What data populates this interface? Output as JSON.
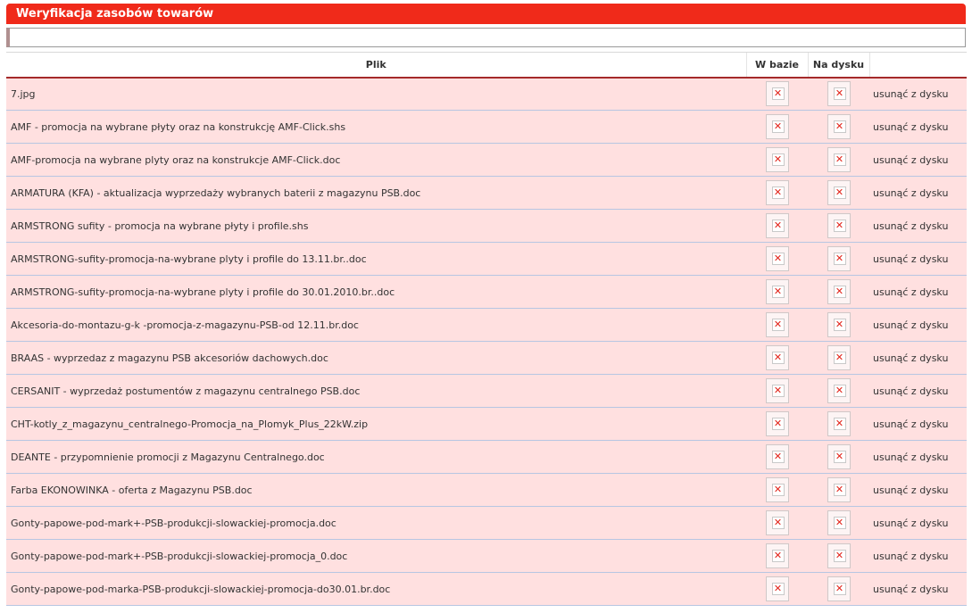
{
  "window": {
    "title": "Weryfikacja zasobów towarów"
  },
  "filter": {
    "value": "",
    "placeholder": ""
  },
  "table": {
    "columns": [
      "Plik",
      "W bazie",
      "Na dysku",
      ""
    ],
    "check_glyph": "✕",
    "check_icon": "red-x-icon",
    "action_label": "usunąć z dysku",
    "rows": [
      {
        "file": "7.jpg",
        "in_db": false,
        "on_disk": false
      },
      {
        "file": "AMF - promocja na wybrane płyty oraz na konstrukcję AMF-Click.shs",
        "in_db": false,
        "on_disk": false
      },
      {
        "file": "AMF-promocja na wybrane plyty oraz na konstrukcje AMF-Click.doc",
        "in_db": false,
        "on_disk": false
      },
      {
        "file": "ARMATURA (KFA) - aktualizacja wyprzedaży wybranych baterii z magazynu PSB.doc",
        "in_db": false,
        "on_disk": false
      },
      {
        "file": "ARMSTRONG sufity - promocja na wybrane płyty i profile.shs",
        "in_db": false,
        "on_disk": false
      },
      {
        "file": "ARMSTRONG-sufity-promocja-na-wybrane plyty i profile do 13.11.br..doc",
        "in_db": false,
        "on_disk": false
      },
      {
        "file": "ARMSTRONG-sufity-promocja-na-wybrane plyty i profile do 30.01.2010.br..doc",
        "in_db": false,
        "on_disk": false
      },
      {
        "file": "Akcesoria-do-montazu-g-k -promocja-z-magazynu-PSB-od 12.11.br.doc",
        "in_db": false,
        "on_disk": false
      },
      {
        "file": "BRAAS - wyprzedaz z magazynu PSB akcesoriów dachowych.doc",
        "in_db": false,
        "on_disk": false
      },
      {
        "file": "CERSANIT - wyprzedaż postumentów z magazynu centralnego PSB.doc",
        "in_db": false,
        "on_disk": false
      },
      {
        "file": "CHT-kotly_z_magazynu_centralnego-Promocja_na_Plomyk_Plus_22kW.zip",
        "in_db": false,
        "on_disk": false
      },
      {
        "file": "DEANTE - przypomnienie promocji z Magazynu Centralnego.doc",
        "in_db": false,
        "on_disk": false
      },
      {
        "file": "Farba EKONOWINKA - oferta z Magazynu PSB.doc",
        "in_db": false,
        "on_disk": false
      },
      {
        "file": "Gonty-papowe-pod-mark+-PSB-produkcji-slowackiej-promocja.doc",
        "in_db": false,
        "on_disk": false
      },
      {
        "file": "Gonty-papowe-pod-mark+-PSB-produkcji-slowackiej-promocja_0.doc",
        "in_db": false,
        "on_disk": false
      },
      {
        "file": "Gonty-papowe-pod-marka-PSB-produkcji-slowackiej-promocja-do30.01.br.doc",
        "in_db": false,
        "on_disk": false
      }
    ]
  },
  "colors": {
    "title_bar": "#f02a1a",
    "row_background": "#ffe0e0",
    "row_separator": "#b7c6e2",
    "header_underline": "#a52a2a",
    "x_mark": "#e2231a"
  }
}
